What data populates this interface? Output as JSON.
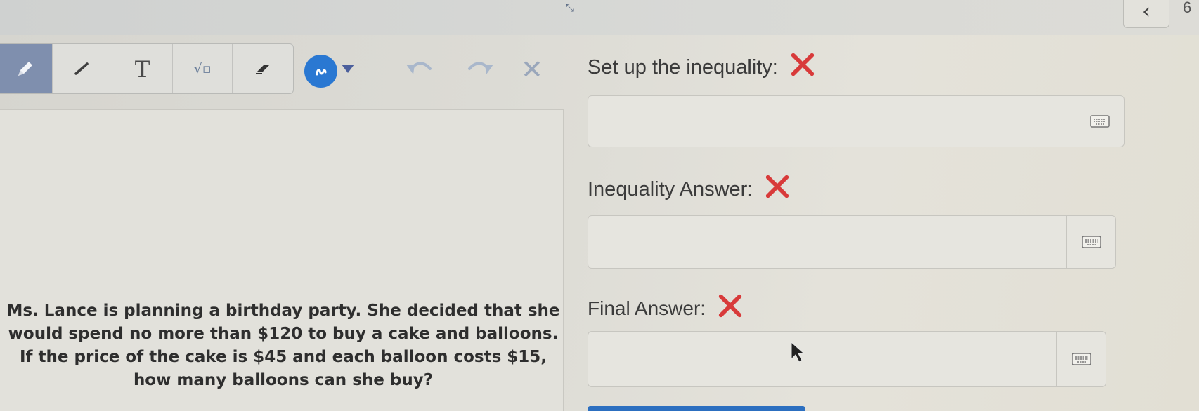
{
  "topbar": {
    "expand_icon": "expand-icon",
    "back_icon": "chevron-left-icon",
    "back_glyph": "‹",
    "page_number": "6"
  },
  "toolbar": {
    "tools": [
      {
        "name": "pencil-icon",
        "active": true
      },
      {
        "name": "line-icon"
      },
      {
        "name": "text-tool",
        "glyph": "T"
      },
      {
        "name": "sqrt-icon",
        "glyph": "√▫"
      },
      {
        "name": "eraser-icon"
      }
    ],
    "color_picker": {
      "name": "color-picker",
      "color": "#2a78d2"
    },
    "undo": "undo-icon",
    "redo": "redo-icon",
    "clear_glyph": "✕"
  },
  "problem": {
    "text": "Ms. Lance is planning a birthday party.  She decided that she\nwould spend no more than $120 to buy a cake and balloons.\nIf the price of the cake is $45 and each balloon costs $15,\nhow many balloons can she buy?"
  },
  "answers": [
    {
      "label": "Set up the inequality:",
      "status": "incorrect",
      "value": "",
      "keyboard_icon": "keyboard-icon"
    },
    {
      "label": "Inequality Answer:",
      "status": "incorrect",
      "value": "",
      "keyboard_icon": "keyboard-icon"
    },
    {
      "label": "Final Answer:",
      "status": "incorrect",
      "value": "",
      "keyboard_icon": "keyboard-icon"
    }
  ],
  "colors": {
    "incorrect": "#d83a3a",
    "accent": "#2a78d2",
    "active_tool": "#7f8fae"
  }
}
